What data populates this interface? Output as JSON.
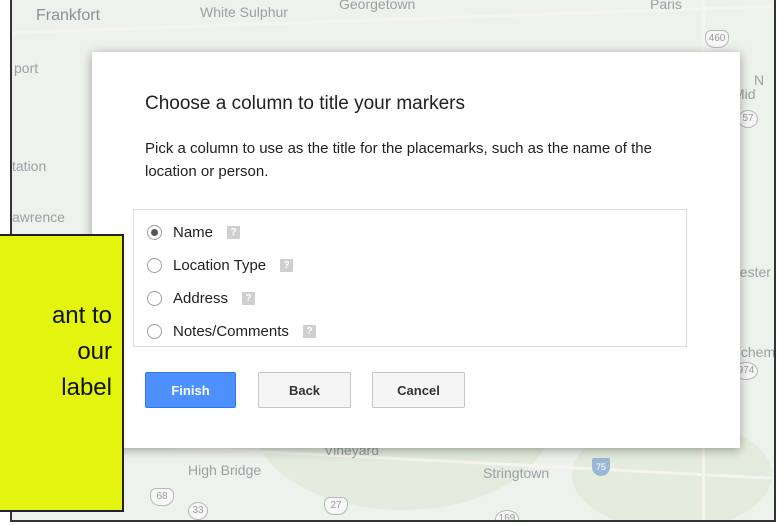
{
  "map": {
    "places": [
      "Frankfort",
      "White Sulphur",
      "Georgetown",
      "Paris",
      "port",
      "tation",
      "awrence",
      "Mid",
      "hester",
      "inchem",
      "High Bridge",
      "Stringtown",
      "N",
      "Vineyard"
    ],
    "shields": [
      "460",
      "57",
      "974",
      "68",
      "33",
      "27",
      "169",
      "75"
    ]
  },
  "dialog": {
    "title": "Choose a column to title your markers",
    "description": "Pick a column to use as the title for the placemarks, such as the name of the location or person.",
    "options": [
      {
        "label": "Name",
        "selected": true
      },
      {
        "label": "Location Type",
        "selected": false
      },
      {
        "label": "Address",
        "selected": false
      },
      {
        "label": "Notes/Comments",
        "selected": false
      }
    ],
    "help_glyph": "?",
    "buttons": {
      "finish": "Finish",
      "back": "Back",
      "cancel": "Cancel"
    }
  },
  "callout": {
    "lines": [
      "ant to",
      "our",
      "label"
    ],
    "color": "#e3f50f"
  },
  "colors": {
    "primary_button": "#4d90fe",
    "map_background": "#eef2ec"
  }
}
